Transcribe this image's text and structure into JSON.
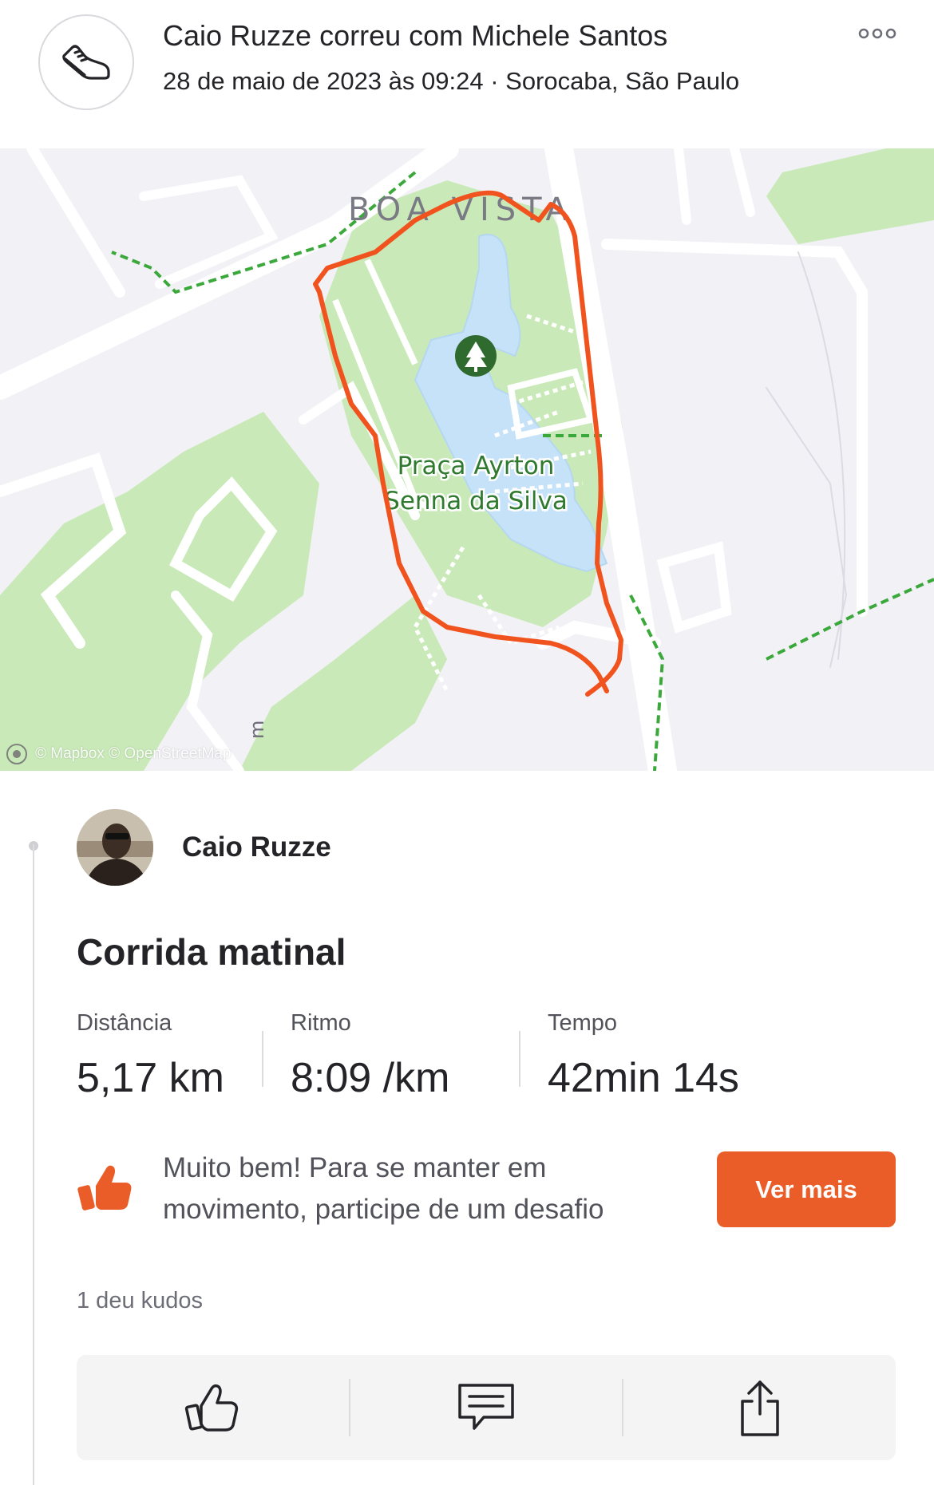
{
  "header": {
    "title": "Caio Ruzze correu com Michele Santos",
    "subtitle": "28 de maio de 2023 às 09:24 · Sorocaba, São Paulo",
    "sport_icon": "running-shoe-icon",
    "more_icon": "more-horizontal-icon"
  },
  "map": {
    "neighborhood_label": "BOA VISTA",
    "park_label_line1": "Praça Ayrton",
    "park_label_line2": "Senna da Silva",
    "scale_label": "m",
    "attribution": "© Mapbox © OpenStreetMap",
    "route_color": "#f1531f",
    "park_color": "#c9eab8",
    "water_color": "#c5e2f8"
  },
  "athlete": {
    "name": "Caio Ruzze"
  },
  "activity": {
    "title": "Corrida matinal",
    "stats": [
      {
        "label": "Distância",
        "value": "5,17 km"
      },
      {
        "label": "Ritmo",
        "value": "8:09 /km"
      },
      {
        "label": "Tempo",
        "value": "42min 14s"
      }
    ]
  },
  "promo": {
    "text": "Muito bem! Para se manter em movimento, participe de um desafio",
    "button_label": "Ver mais",
    "icon": "thumbs-up-icon",
    "accent": "#ea5d29"
  },
  "kudos": {
    "count_text": "1 deu kudos"
  },
  "actions": {
    "items": [
      "kudos-icon",
      "comment-icon",
      "share-icon"
    ]
  }
}
